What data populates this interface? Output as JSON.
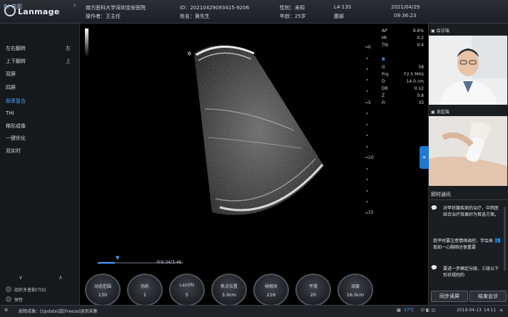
{
  "header": {
    "logo_text": "Lanmage",
    "hospital": "南方医科大学深圳宝安医院",
    "operator": "操作者：王主任",
    "id": "ID：20210429093415-9206",
    "name": "姓名：黄先生",
    "gender": "性别：未知",
    "age": "年龄：25岁",
    "probe": "L4-13S",
    "region": "腹部",
    "date": "2021/04/29",
    "time": "09:36:23"
  },
  "left_panel": {
    "title": "B/ 电影",
    "chevron": "›",
    "items": [
      {
        "label": "左右翻转",
        "value": "左"
      },
      {
        "label": "上下翻转",
        "value": "上"
      },
      {
        "label": "双屏",
        "value": ""
      },
      {
        "label": "四屏",
        "value": ""
      },
      {
        "label": "频率复合",
        "value": ""
      },
      {
        "label": "THI",
        "value": ""
      },
      {
        "label": "梯形成像",
        "value": ""
      },
      {
        "label": "一键优化",
        "value": ""
      },
      {
        "label": "双实时",
        "value": ""
      }
    ],
    "active_index": 4,
    "arrow_down": "∨",
    "arrow_up": "∧",
    "options": [
      "组织多普勒(TDI)",
      "弹性"
    ]
  },
  "depth_scale": [
    "0",
    "5",
    "10",
    "15"
  ],
  "params_top": [
    {
      "name": "AP",
      "value": "9.6%"
    },
    {
      "name": "MI",
      "value": "0.2"
    },
    {
      "name": "TIS",
      "value": "0.4"
    }
  ],
  "params_mode": "B",
  "params_b": [
    {
      "name": "G",
      "value": "58"
    },
    {
      "name": "Frq",
      "value": "F2.5 MHz"
    },
    {
      "name": "D",
      "value": "14.0 cm"
    },
    {
      "name": "DR",
      "value": "0.12"
    },
    {
      "name": "Z",
      "value": "0.8"
    },
    {
      "name": "Fr",
      "value": "33"
    }
  ],
  "right_panel": {
    "meeting_label": "会诊端",
    "initiator_label": "发起端",
    "chat_title": "即时通讯",
    "messages": [
      "对甲状腺疾病的治疗，中西医结合治疗效果好为首选方案。",
      "我平时要注意情绪调控，学会表现如一心胸顺达很重要",
      "要进一步确定分级，三级以下形状规则的"
    ],
    "sync_button": "同步读屏",
    "end_button": "结束会诊",
    "expand_icon": "»"
  },
  "knobs": [
    {
      "label": "动态范围",
      "value": "130"
    },
    {
      "label": "伪彩",
      "value": "1"
    },
    {
      "label": "LanSRI",
      "value": "5"
    },
    {
      "label": "焦点位置",
      "value": "3.0cm"
    },
    {
      "label": "帧相关",
      "value": "216"
    },
    {
      "label": "平滑",
      "value": "20"
    },
    {
      "label": "深度",
      "value": "16.0cm"
    }
  ],
  "cine": {
    "frame_text": "Fr9:34/3:46",
    "progress": 0.2
  },
  "status_bar": {
    "left_text": "故障成像：[Update]或[Freeze]退到采集",
    "temperature": "37℃",
    "date": "2019-04-13",
    "time": "14:11"
  },
  "colors": {
    "accent": "#4ea3ff",
    "expand_tab": "#1e7ad0"
  }
}
